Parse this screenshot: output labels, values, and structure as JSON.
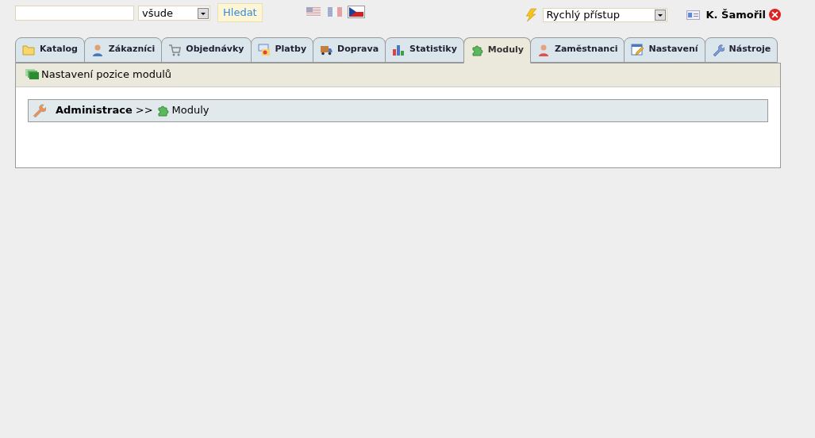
{
  "search": {
    "scope": "všude",
    "button": "Hledat"
  },
  "languages": [
    {
      "kind": "us",
      "selected": false
    },
    {
      "kind": "fr",
      "selected": false
    },
    {
      "kind": "cz",
      "selected": true
    }
  ],
  "quick_access": {
    "value": "Rychlý přístup"
  },
  "user": {
    "name": "K. Šamořil"
  },
  "tabs": [
    {
      "label": "Katalog",
      "selected": false
    },
    {
      "label": "Zákazníci",
      "selected": false
    },
    {
      "label": "Objednávky",
      "selected": false
    },
    {
      "label": "Platby",
      "selected": false
    },
    {
      "label": "Doprava",
      "selected": false
    },
    {
      "label": "Statistiky",
      "selected": false
    },
    {
      "label": "Moduly",
      "selected": true
    },
    {
      "label": "Zaměstnanci",
      "selected": false
    },
    {
      "label": "Nastavení",
      "selected": false
    },
    {
      "label": "Nástroje",
      "selected": false
    }
  ],
  "panel": {
    "title": "Nastavení pozice modulů"
  },
  "breadcrumb": {
    "root": "Administrace",
    "separator": ">>",
    "current": "Moduly"
  }
}
